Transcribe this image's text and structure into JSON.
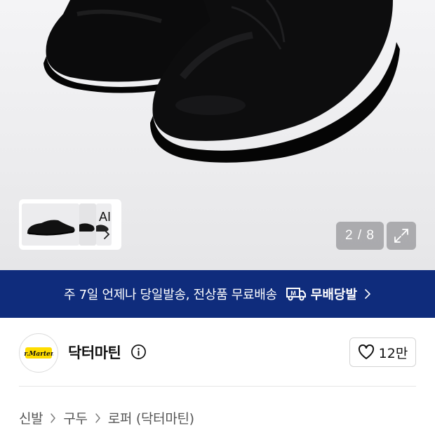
{
  "gallery": {
    "ai_label": "AI",
    "counter": "2 / 8"
  },
  "delivery_banner": {
    "text": "주 7일 언제나 당일발송, 전상품 무료배송",
    "badge_label": "무배당발",
    "badge_icon": "M",
    "background": "#0f2c7c"
  },
  "brand": {
    "name": "닥터마틴",
    "logo_text": "Dr. Martens",
    "like_count": "12만"
  },
  "breadcrumb": [
    "신발",
    "구두",
    "로퍼 (닥터마틴)"
  ]
}
